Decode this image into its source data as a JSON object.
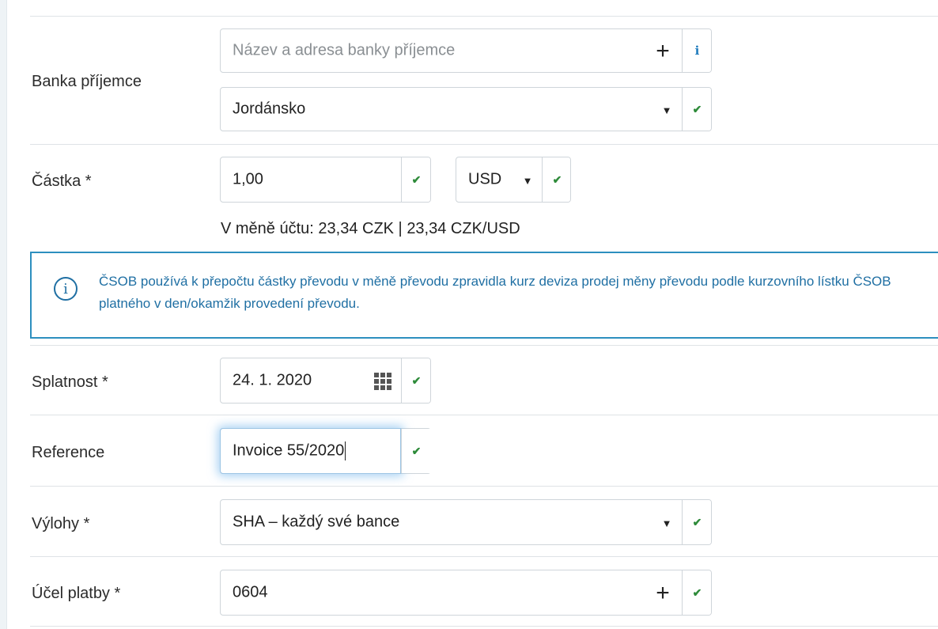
{
  "bank": {
    "label": "Banka příjemce",
    "name_placeholder": "Název a adresa banky příjemce",
    "country_value": "Jordánsko"
  },
  "amount": {
    "label": "Částka *",
    "value": "1,00",
    "currency": "USD",
    "hint": "V měně účtu: 23,34 CZK | 23,34 CZK/USD"
  },
  "notice": {
    "text": "ČSOB používá k přepočtu částky převodu v měně převodu zpravidla kurz deviza prodej měny převodu podle kurzovního lístku ČSOB platného v den/okamžik provedení převodu."
  },
  "due_date": {
    "label": "Splatnost *",
    "value": "24. 1. 2020"
  },
  "reference": {
    "label": "Reference",
    "value": "Invoice 55/2020"
  },
  "fees": {
    "label": "Výlohy *",
    "value": "SHA – každý své bance"
  },
  "purpose": {
    "label": "Účel platby *",
    "value": "0604"
  },
  "icons": {
    "check": "✔",
    "plus": "+",
    "caret": "▼",
    "info": "i",
    "calendar": "calendar-grid-icon"
  },
  "colors": {
    "check": "#2e8b3a",
    "info_blue": "#1f7bbd",
    "notice_border": "#2d8fbf",
    "notice_text": "#1f6fa3"
  }
}
